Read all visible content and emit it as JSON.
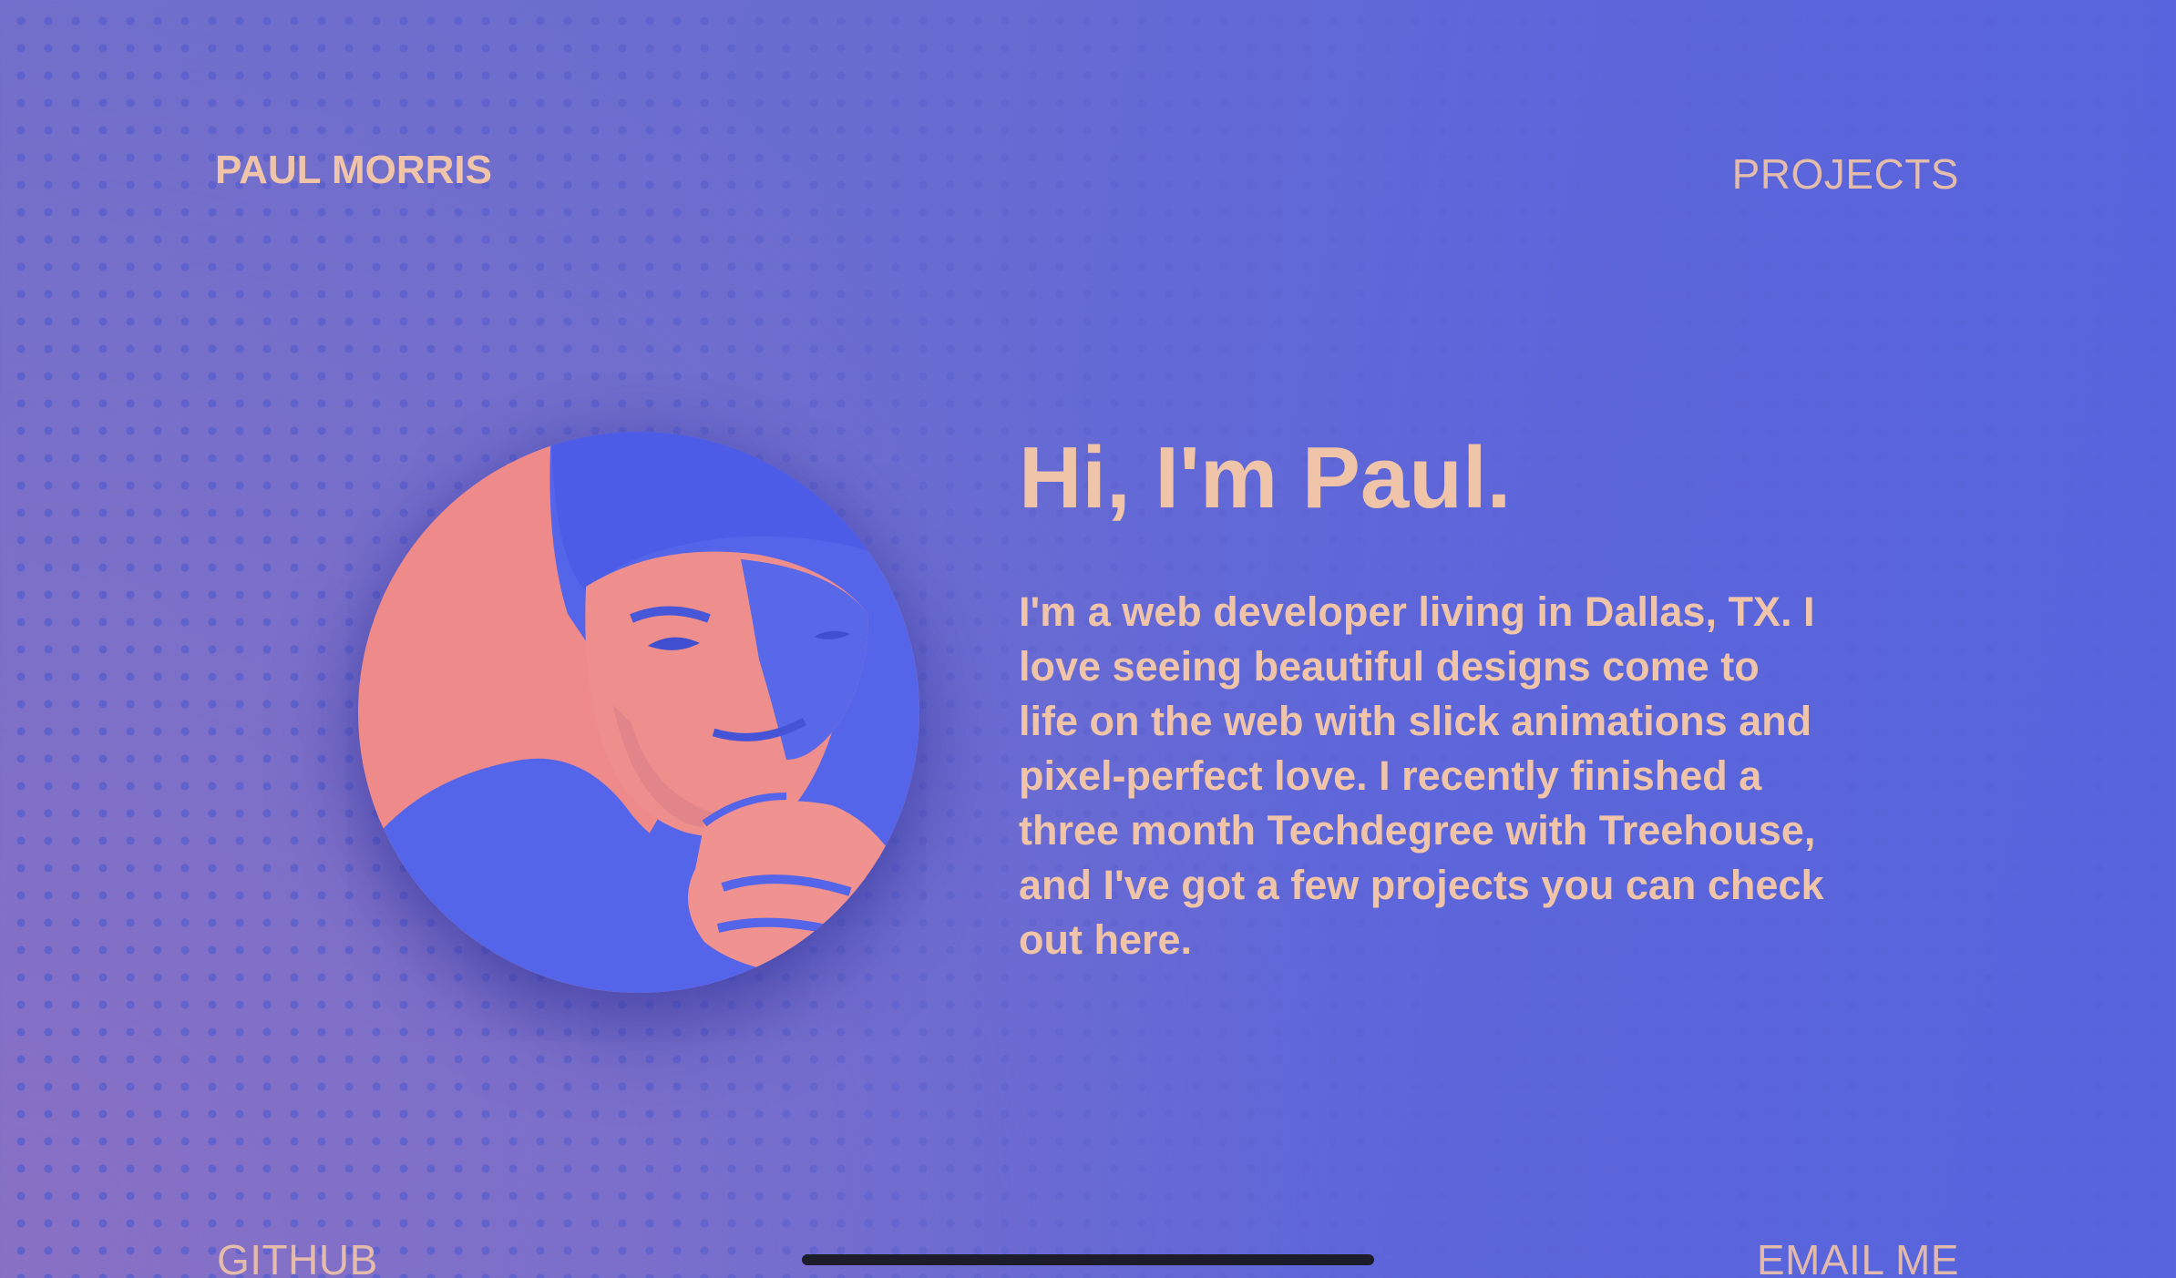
{
  "colors": {
    "accent_text": "#f0c4a8",
    "background_start": "#6f6fcb",
    "background_end": "#5664de",
    "photo_blue": "#5565ea",
    "photo_pink": "#ee8a8a"
  },
  "header": {
    "brand": "PAUL MORRIS",
    "nav_projects": "PROJECTS"
  },
  "hero": {
    "avatar_icon": "portrait-photo",
    "headline": "Hi, I'm Paul.",
    "bio": "I'm a web developer living in Dallas, TX. I love seeing beautiful designs come to life on the web with slick animations and pixel-perfect love. I recently finished a three month Techdegree with Treehouse, and I've got a few projects you can check out here."
  },
  "footer": {
    "github": "GITHUB",
    "email": "EMAIL ME"
  }
}
